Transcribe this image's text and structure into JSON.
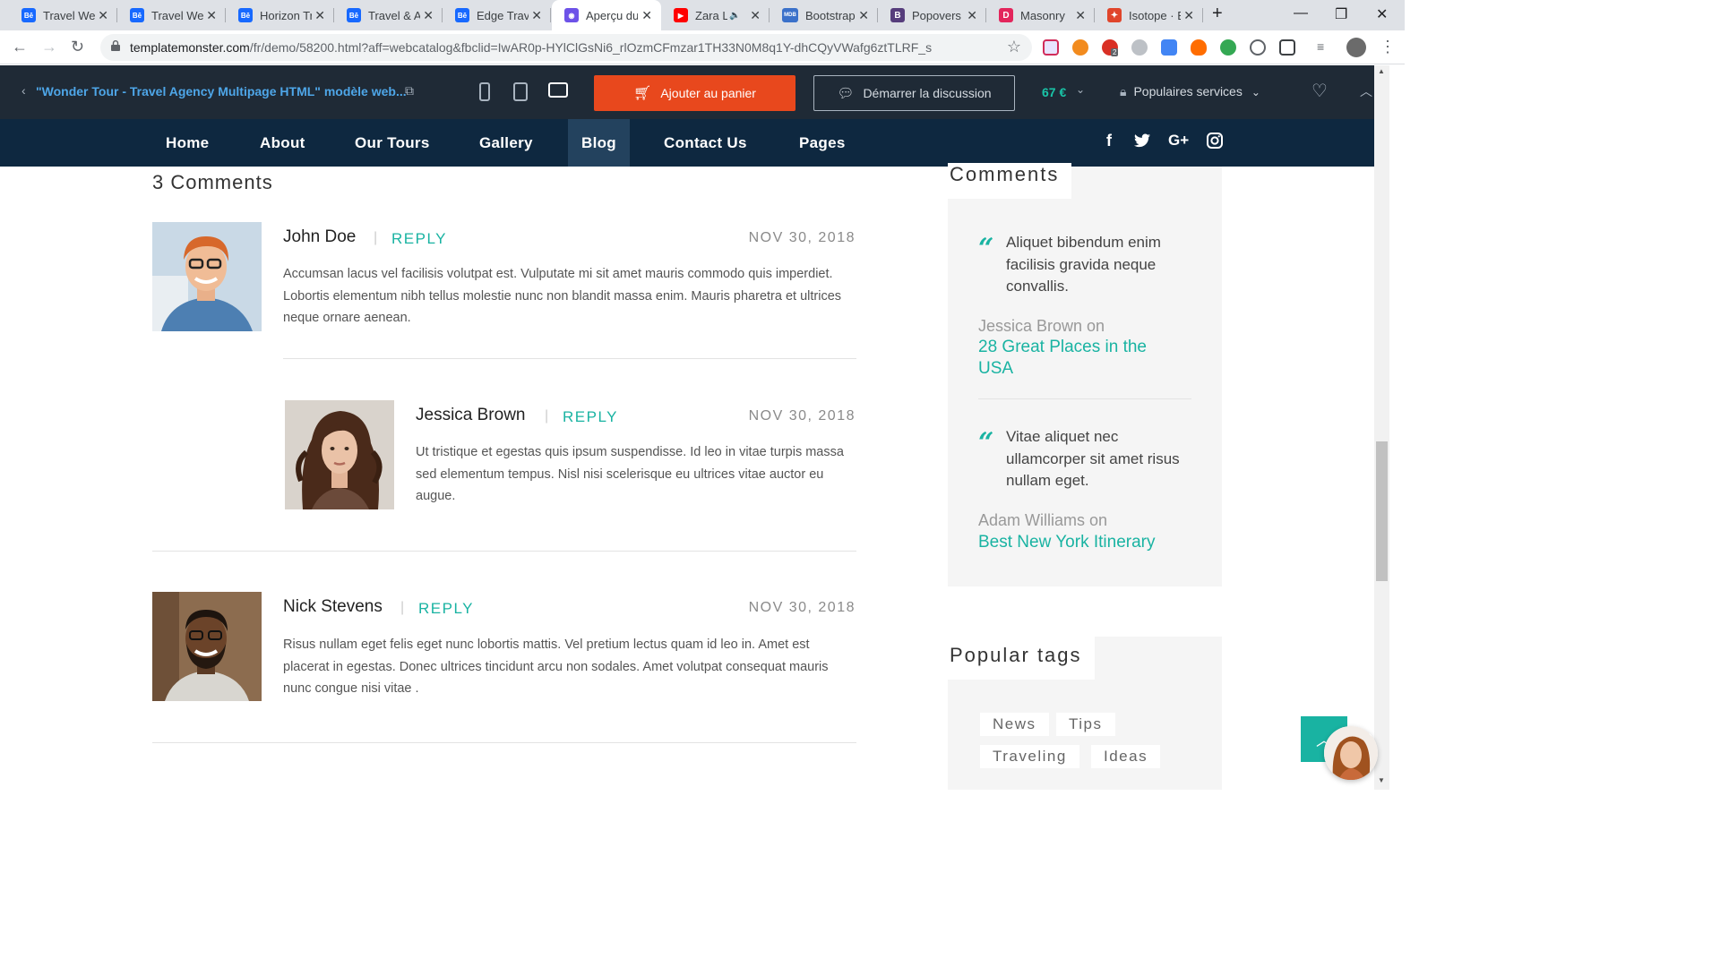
{
  "browser": {
    "tabs": [
      {
        "title": "Travel Web",
        "favicon": "behance-icon",
        "fav_text": "Bē",
        "fav_color": "#1769ff"
      },
      {
        "title": "Travel Web",
        "favicon": "behance-icon",
        "fav_text": "Bē",
        "fav_color": "#1769ff"
      },
      {
        "title": "Horizon Tr",
        "favicon": "behance-icon",
        "fav_text": "Bē",
        "fav_color": "#1769ff"
      },
      {
        "title": "Travel & A",
        "favicon": "behance-icon",
        "fav_text": "Bē",
        "fav_color": "#1769ff"
      },
      {
        "title": "Edge Trave",
        "favicon": "behance-icon",
        "fav_text": "Bē",
        "fav_color": "#1769ff"
      },
      {
        "title": "Aperçu du",
        "favicon": "templatemonster-icon",
        "fav_text": "◉",
        "fav_color": "#6d52e8",
        "active": true
      },
      {
        "title": "Zara L",
        "favicon": "youtube-icon",
        "fav_text": "▶",
        "fav_color": "#ff0000",
        "audio": "🔈"
      },
      {
        "title": "Bootstrap",
        "favicon": "mdb-icon",
        "fav_text": "MDB",
        "fav_color": "#3b71ca"
      },
      {
        "title": "Popovers",
        "favicon": "bootstrap-icon",
        "fav_text": "B",
        "fav_color": "#563d7c"
      },
      {
        "title": "Masonry",
        "favicon": "masonry-icon",
        "fav_text": "D",
        "fav_color": "#e3255c"
      },
      {
        "title": "Isotope · E",
        "favicon": "isotope-icon",
        "fav_text": "✦",
        "fav_color": "#e0452b"
      }
    ],
    "new_tab": "+",
    "window_controls": {
      "minimize": "—",
      "maximize": "❐",
      "close": "✕"
    },
    "url_host": "templatemonster.com",
    "url_path": "/fr/demo/58200.html?aff=webcatalog&fbclid=IwAR0p-HYlClGsNi6_rlOzmCFmzar1TH33N0M8q1Y-dhCQyVWafg6ztTLRF_s",
    "extension_badge": "2"
  },
  "demo_bar": {
    "back_glyph": "‹",
    "title": "\"Wonder Tour - Travel Agency Multipage HTML\" modèle web...",
    "cart_label": "Ajouter au panier",
    "chat_label": "Démarrer la discussion",
    "price": "67 €",
    "services_label": "Populaires services"
  },
  "nav": {
    "items": [
      "Home",
      "About",
      "Our Tours",
      "Gallery",
      "Blog",
      "Contact Us",
      "Pages"
    ],
    "active": "Blog",
    "social": [
      "f",
      "🐦",
      "G+",
      "◎"
    ]
  },
  "comments": {
    "heading": "3 Comments",
    "list": [
      {
        "name": "John Doe",
        "reply": "REPLY",
        "date": "NOV 30, 2018",
        "text": "Accumsan lacus vel facilisis volutpat est. Vulputate mi sit amet mauris commodo quis imperdiet. Lobortis elementum nibh tellus molestie nunc non blandit massa enim. Mauris pharetra et ultrices neque ornare aenean."
      },
      {
        "name": "Jessica Brown",
        "reply": "REPLY",
        "date": "NOV 30, 2018",
        "text": "Ut tristique et egestas quis ipsum suspendisse. Id leo in vitae turpis massa sed elementum tempus. Nisl nisi scelerisque eu ultrices vitae auctor eu augue."
      },
      {
        "name": "Nick Stevens",
        "reply": "REPLY",
        "date": "NOV 30, 2018",
        "text": "Risus nullam eget felis eget nunc lobortis mattis. Vel pretium lectus quam id leo in. Amet est placerat in egestas. Donec ultrices tincidunt arcu non sodales. Amet volutpat consequat mauris nunc congue nisi vitae ."
      }
    ]
  },
  "sidebar": {
    "comments_title": "Comments",
    "quotes": [
      {
        "text": "Aliquet bibendum enim facilisis gravida neque convallis.",
        "author": "Jessica Brown on",
        "link": "28 Great Places in the USA"
      },
      {
        "text": "Vitae aliquet nec ullamcorper sit amet risus nullam eget.",
        "author": "Adam Williams on",
        "link": "Best New York Itinerary"
      }
    ],
    "tags_title": "Popular tags",
    "tags": [
      "News",
      "Tips",
      "Traveling",
      "Ideas"
    ]
  },
  "colors": {
    "accent": "#19b3a2",
    "cart": "#e8481d",
    "nav_bg": "#0e2840",
    "bar_bg": "#1f2a36",
    "price": "#19c5a8"
  }
}
